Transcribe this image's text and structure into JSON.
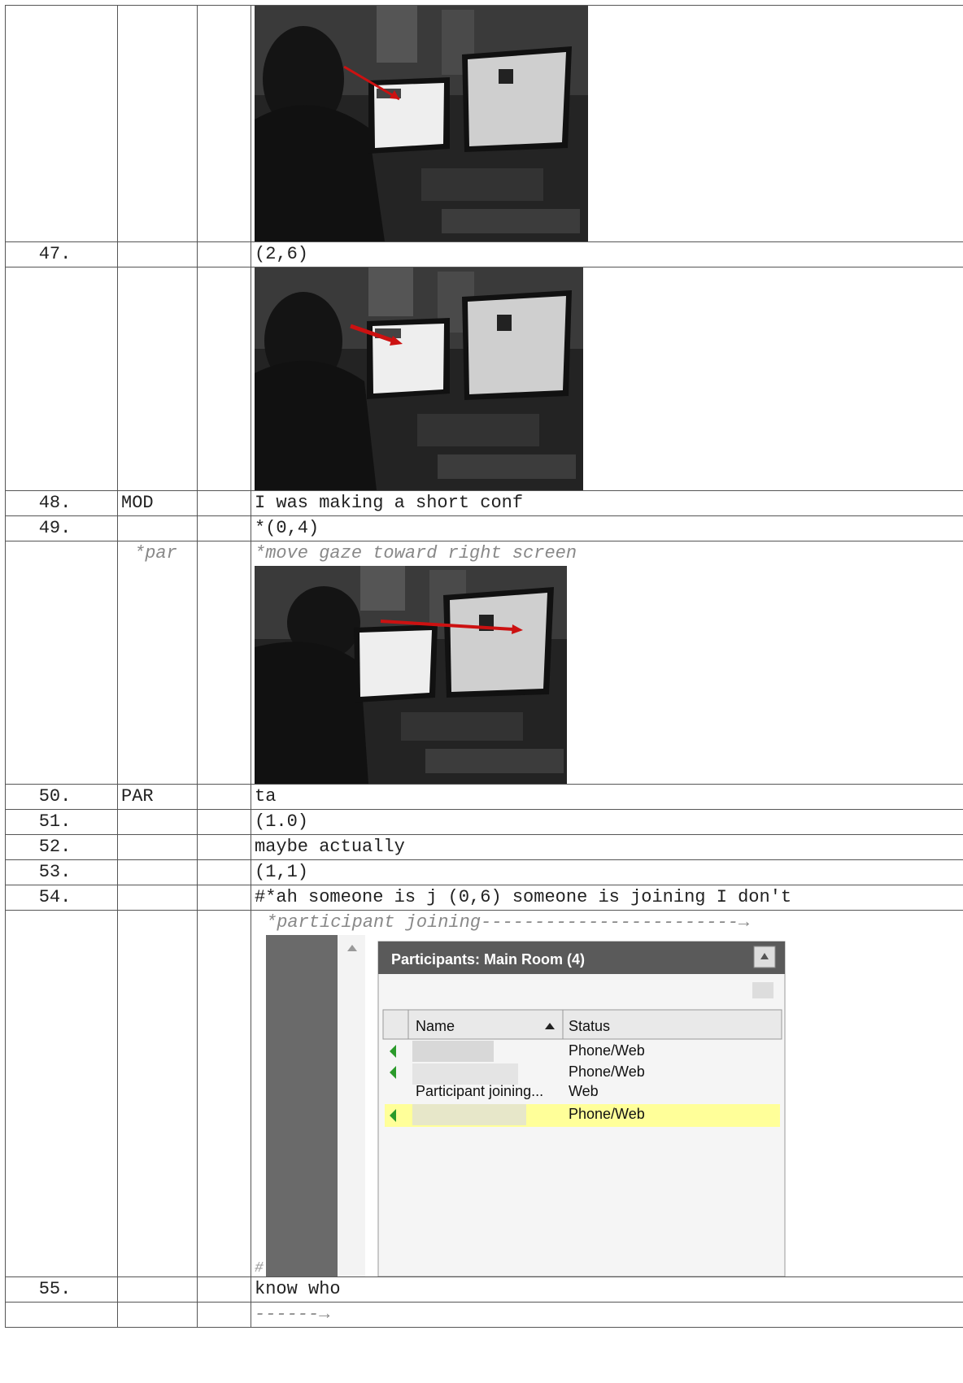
{
  "rows": [
    {
      "line": "",
      "speaker": "",
      "text": ""
    },
    {
      "line": "47.",
      "speaker": "",
      "text": "(2,6)"
    },
    {
      "line": "",
      "speaker": "",
      "text": ""
    },
    {
      "line": "48.",
      "speaker": "MOD",
      "text": "I was making a short conf"
    },
    {
      "line": "49.",
      "speaker": "",
      "text": "*(0,4)"
    },
    {
      "line": "",
      "speaker": "*par",
      "text": "*move gaze toward right screen"
    },
    {
      "line": "50.",
      "speaker": "PAR",
      "text": "ta"
    },
    {
      "line": "51.",
      "speaker": "",
      "text": "(1.0)"
    },
    {
      "line": "52.",
      "speaker": "",
      "text": "maybe actually"
    },
    {
      "line": "53.",
      "speaker": "",
      "text": "(1,1)"
    },
    {
      "line": "54.",
      "speaker": "",
      "text": "#*ah someone is j (0,6) someone is joining I don't"
    },
    {
      "line": "",
      "speaker": "",
      "text": "*participant joining------------------------→"
    },
    {
      "line": "55.",
      "speaker": "",
      "text": "know who"
    },
    {
      "line": "",
      "speaker": "",
      "text": "------→"
    }
  ],
  "participants_panel": {
    "title": "Participants: Main Room (4)",
    "col_name": "Name",
    "col_status": "Status",
    "entries": [
      {
        "name": "",
        "status": "Phone/Web",
        "audio": true
      },
      {
        "name": "",
        "status": "Phone/Web",
        "audio": true
      },
      {
        "name": "Participant joining...",
        "status": "Web",
        "audio": false
      },
      {
        "name": "",
        "status": "Phone/Web",
        "audio": true
      }
    ],
    "hash_mark": "#"
  },
  "colors": {
    "arrow": "#cc1111",
    "highlight": "#ffff99",
    "panel_header": "#6a6a6a"
  }
}
